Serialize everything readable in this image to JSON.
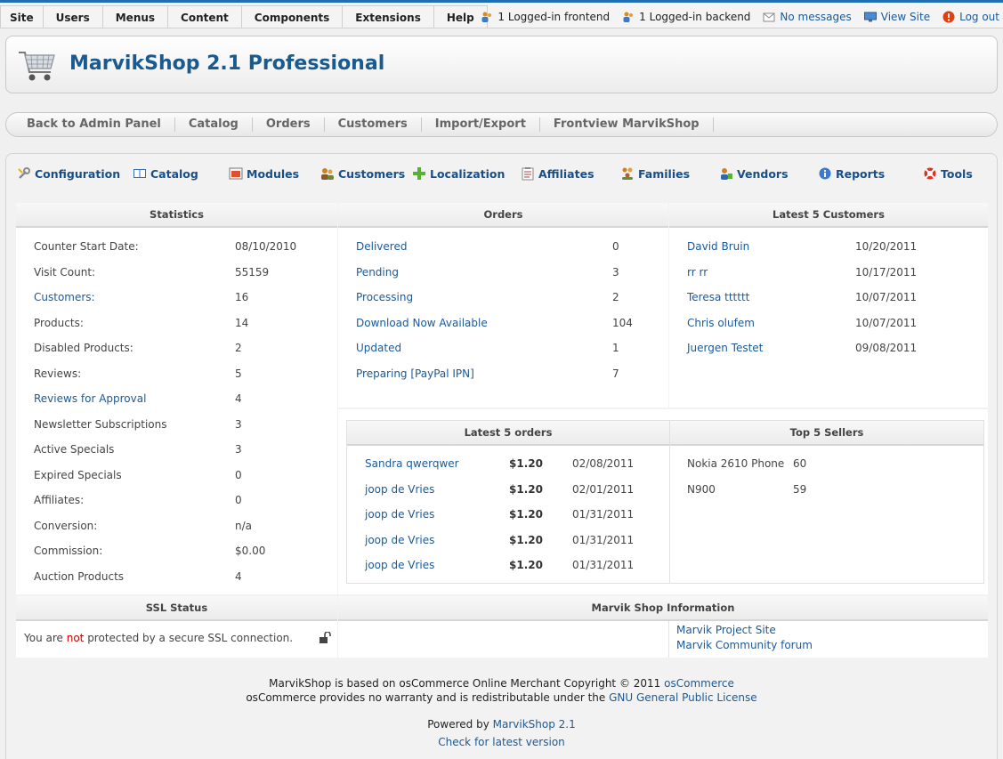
{
  "topbar": {
    "menus": [
      "Site",
      "Users",
      "Menus",
      "Content",
      "Components",
      "Extensions",
      "Help"
    ],
    "frontend": "1 Logged-in frontend",
    "backend": "1 Logged-in backend",
    "messages": "No messages",
    "view_site": "View Site",
    "logout": "Log out"
  },
  "header": {
    "title": "MarvikShop 2.1 Professional"
  },
  "nav": [
    "Back to Admin Panel",
    "Catalog",
    "Orders",
    "Customers",
    "Import/Export",
    "Frontview MarvikShop"
  ],
  "toolbar": [
    "Configuration",
    "Catalog",
    "Modules",
    "Customers",
    "Localization",
    "Affiliates",
    "Families",
    "Vendors",
    "Reports",
    "Tools"
  ],
  "statistics": {
    "title": "Statistics",
    "rows": [
      {
        "label": "Counter Start Date:",
        "value": "08/10/2010"
      },
      {
        "label": "Visit Count:",
        "value": "55159"
      },
      {
        "label": "Customers:",
        "value": "16"
      },
      {
        "label": "Products:",
        "value": "14"
      },
      {
        "label": "Disabled Products:",
        "value": "2"
      },
      {
        "label": "Reviews:",
        "value": "5"
      },
      {
        "label": "Reviews for Approval",
        "value": "4"
      },
      {
        "label": "Newsletter Subscriptions",
        "value": "3"
      },
      {
        "label": "Active Specials",
        "value": "3"
      },
      {
        "label": "Expired Specials",
        "value": "0"
      },
      {
        "label": "Affiliates:",
        "value": "0"
      },
      {
        "label": "Conversion:",
        "value": "n/a"
      },
      {
        "label": "Commission:",
        "value": "$0.00"
      },
      {
        "label": "Auction Products",
        "value": "4"
      }
    ]
  },
  "orders": {
    "title": "Orders",
    "rows": [
      {
        "label": "Delivered",
        "value": "0"
      },
      {
        "label": "Pending",
        "value": "3"
      },
      {
        "label": "Processing",
        "value": "2"
      },
      {
        "label": "Download Now Available",
        "value": "104"
      },
      {
        "label": "Updated",
        "value": "1"
      },
      {
        "label": "Preparing [PayPal IPN]",
        "value": "7"
      }
    ]
  },
  "latest_customers": {
    "title": "Latest 5 Customers",
    "rows": [
      {
        "name": "David Bruin",
        "date": "10/20/2011"
      },
      {
        "name": "rr rr",
        "date": "10/17/2011"
      },
      {
        "name": "Teresa tttttt",
        "date": "10/07/2011"
      },
      {
        "name": "Chris olufem",
        "date": "10/07/2011"
      },
      {
        "name": "Juergen Testet",
        "date": "09/08/2011"
      }
    ]
  },
  "latest_orders": {
    "title": "Latest 5 orders",
    "rows": [
      {
        "name": "Sandra qwerqwer",
        "amount": "$1.20",
        "date": "02/08/2011"
      },
      {
        "name": "joop de Vries",
        "amount": "$1.20",
        "date": "02/01/2011"
      },
      {
        "name": "joop de Vries",
        "amount": "$1.20",
        "date": "01/31/2011"
      },
      {
        "name": "joop de Vries",
        "amount": "$1.20",
        "date": "01/31/2011"
      },
      {
        "name": "joop de Vries",
        "amount": "$1.20",
        "date": "01/31/2011"
      }
    ]
  },
  "top_sellers": {
    "title": "Top 5 Sellers",
    "rows": [
      {
        "name": "Nokia 2610 Phone",
        "value": "60"
      },
      {
        "name": "N900",
        "value": "59"
      }
    ]
  },
  "ssl": {
    "title": "SSL Status",
    "text_before": "You are ",
    "text_not": "not",
    "text_after": " protected by a secure SSL connection."
  },
  "info": {
    "title": "Marvik Shop Information",
    "project_site": "Marvik Project Site",
    "forum": "Marvik Community forum"
  },
  "footer": {
    "line1_text": "MarvikShop is based on osCommerce Online Merchant Copyright © 2011 ",
    "line1_link": "osCommerce",
    "line2_text": "osCommerce provides no warranty and is redistributable under the ",
    "line2_link": "GNU General Public License",
    "powered_text": "Powered by ",
    "powered_link": "MarvikShop 2.1",
    "check": "Check for latest version"
  },
  "colors": {
    "accent": "#1f6fb5",
    "link": "#1a5a9a",
    "title": "#1a5a8e",
    "warn": "#cc0000"
  }
}
